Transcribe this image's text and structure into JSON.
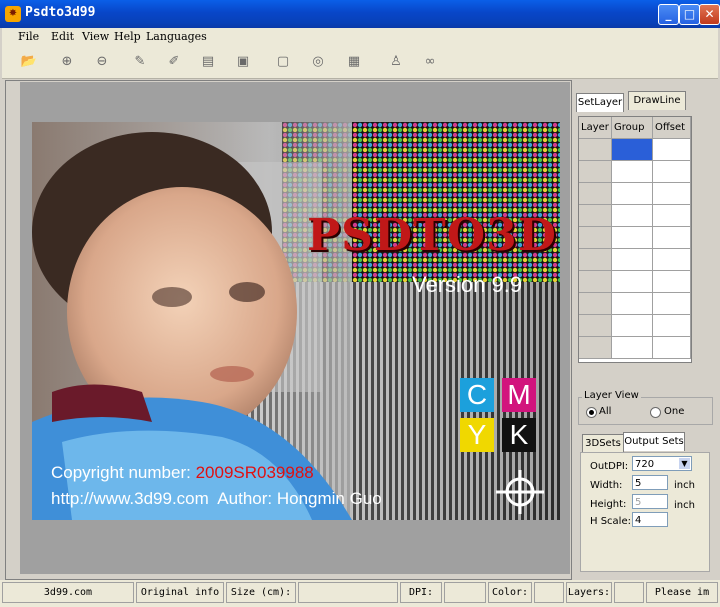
{
  "window": {
    "title": "Psdto3d99",
    "minimize": "_",
    "maximize": "□",
    "close": "✕"
  },
  "menu": [
    "File",
    "Edit",
    "View",
    "Help",
    "Languages"
  ],
  "toolbar_icons": [
    "open-folder",
    "zoom-in",
    "zoom-out",
    "pencil",
    "brush",
    "edit-document",
    "image-edit",
    "rounded-rect",
    "target",
    "save",
    "figure",
    "link"
  ],
  "splash": {
    "logo": "PSDTO3D",
    "version": "Version 9.9",
    "cmyk": [
      "C",
      "M",
      "Y",
      "K"
    ],
    "copyright_label": "Copyright number: ",
    "copyright_number": "2009SR039988",
    "url_author": "http://www.3d99.com  Author: Hongmin Guo"
  },
  "right_panel": {
    "tabs": [
      "SetLayer",
      "DrawLine"
    ],
    "columns": [
      "Layer",
      "Group",
      "Offset"
    ],
    "layer_view": {
      "title": "Layer View",
      "options": [
        "All",
        "One"
      ],
      "selected": "All"
    },
    "set_tabs": [
      "3DSets",
      "Output Sets"
    ],
    "output": {
      "dpi_label": "OutDPI:",
      "dpi_value": "720",
      "width_label": "Width:",
      "width_value": "5",
      "width_unit": "inch",
      "height_label": "Height:",
      "height_value": "5",
      "height_unit": "inch",
      "hscale_label": "H Scale:",
      "hscale_value": "4"
    }
  },
  "status": {
    "site": "3d99.com",
    "original_info": "Original info",
    "size": "Size (cm):",
    "dpi": "DPI:",
    "color": "Color:",
    "layers": "Layers:",
    "message": "Please im"
  },
  "colors": {
    "cyan": "#1ca0dc",
    "magenta": "#d2147d",
    "yellow": "#f0d800",
    "black": "#111111",
    "copyright_red": "#e01010"
  }
}
